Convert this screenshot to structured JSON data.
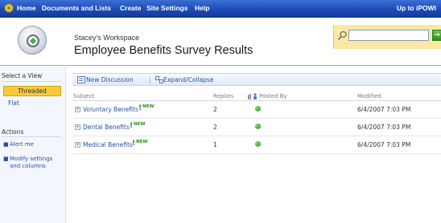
{
  "topnav": {
    "items": [
      "Home",
      "Documents and Lists",
      "Create",
      "Site Settings",
      "Help"
    ],
    "up_to": "Up to iPOWI"
  },
  "header": {
    "workspace": "Stacey's Workspace",
    "title": "Employee Benefits Survey Results"
  },
  "search": {
    "value": "",
    "go_label": "→"
  },
  "leftnav": {
    "view_heading": "Select a View",
    "views": [
      "Threaded",
      "Flat"
    ],
    "actions_heading": "Actions",
    "actions": [
      "Alert me",
      "Modify settings and columns"
    ]
  },
  "toolbar": {
    "new_discussion": "New Discussion",
    "separator": "|",
    "expand_collapse": "Expand/Collapse"
  },
  "table": {
    "columns": [
      "Subject",
      "Replies",
      "Posted By",
      "Modified"
    ],
    "new_tag": "NEW",
    "rows": [
      {
        "subject": "Voluntary Benefits",
        "replies": "2",
        "modified": "6/4/2007 7:03 PM"
      },
      {
        "subject": "Dental Benefits",
        "replies": "2",
        "modified": "6/4/2007 7:03 PM"
      },
      {
        "subject": "Medical Benefits",
        "replies": "1",
        "modified": "6/4/2007 7:03 PM"
      }
    ]
  },
  "colors": {
    "topbar": "#1c49b5",
    "selected_view": "#f7c93b",
    "search_panel": "#fbe7a6",
    "link": "#2a4fa6",
    "new_tag": "#2f8a1e"
  },
  "icons": [
    "home-icon",
    "site-logo-icon",
    "search-icon",
    "go-arrow-icon",
    "new-discussion-icon",
    "expand-collapse-icon",
    "attachment-icon",
    "person-icon",
    "presence-icon",
    "expand-icon"
  ]
}
